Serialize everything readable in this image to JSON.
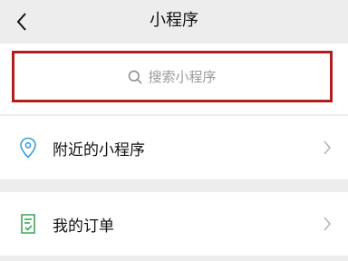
{
  "header": {
    "title": "小程序",
    "back_icon": "chevron-left-icon"
  },
  "search": {
    "placeholder": "搜索小程序",
    "icon": "search-icon",
    "highlight_color": "#b21d1d"
  },
  "list": {
    "nearby": {
      "label": "附近的小程序",
      "icon": "location-pin-icon",
      "icon_color": "#3b9cd9"
    },
    "orders": {
      "label": "我的订单",
      "icon": "order-document-icon",
      "icon_color": "#3aa757"
    }
  }
}
